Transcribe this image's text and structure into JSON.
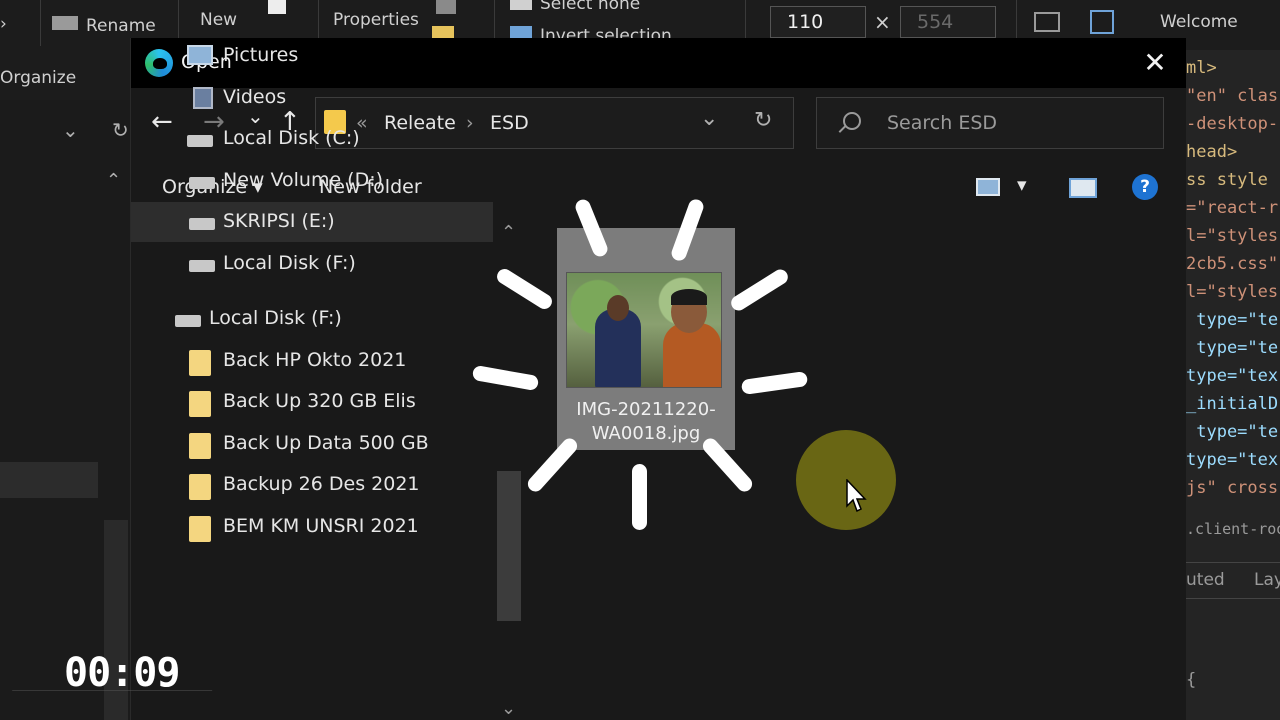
{
  "background": {
    "ribbon": {
      "rename": "Rename",
      "new": "New",
      "properties": "Properties",
      "select_none": "Select none",
      "invert_selection": "Invert selection",
      "organize": "Organize",
      "width": "110",
      "times": "×",
      "height": "554",
      "welcome": "Welcome"
    },
    "code_lines": [
      [
        "tag",
        "ml>"
      ],
      [
        "str",
        "\"en\" clas"
      ],
      [
        "str",
        "-desktop-"
      ],
      [
        "tag",
        "head>"
      ],
      [
        "tag",
        "ss style"
      ],
      [
        "str",
        "=\"react-r"
      ],
      [
        "str",
        "l=\"styles"
      ],
      [
        "str",
        "2cb5.css\""
      ],
      [
        "str",
        "l=\"styles"
      ],
      [
        "attr",
        " type=\"te"
      ],
      [
        "attr",
        " type=\"te"
      ],
      [
        "attr",
        "type=\"tex"
      ],
      [
        "attr",
        "_initialD"
      ],
      [
        "attr",
        " type=\"te"
      ],
      [
        "attr",
        "type=\"tex"
      ],
      [
        "str",
        "js\" cross"
      ]
    ],
    "code_selector": ".client-root",
    "code_tabs": [
      "uted",
      "Lay"
    ],
    "code_brace": "{"
  },
  "dialog": {
    "title": "Open",
    "close_glyph": "✕",
    "nav": {
      "back_glyph": "←",
      "forward_glyph": "→",
      "recent_glyph": "⌄",
      "up_glyph": "↑"
    },
    "address": {
      "overflow": "«",
      "crumbs": [
        "Releate",
        "ESD"
      ],
      "separator": "›",
      "dropdown_glyph": "⌄",
      "refresh_glyph": "↻"
    },
    "search": {
      "placeholder": "Search ESD"
    },
    "commands": {
      "organize": "Organize ▾",
      "new_folder": "New folder",
      "view_dropdown": "▾",
      "help": "?"
    },
    "nav_pane": {
      "items": [
        {
          "label": "Pictures",
          "icon": "pictures-icon"
        },
        {
          "label": "Videos",
          "icon": "videos-icon"
        },
        {
          "label": "Local Disk (C:)",
          "icon": "system-drive-icon"
        },
        {
          "label": "New Volume (D:)",
          "icon": "drive-icon"
        },
        {
          "label": "SKRIPSI (E:)",
          "icon": "drive-icon",
          "selected": true
        },
        {
          "label": "Local Disk (F:)",
          "icon": "drive-icon"
        },
        {
          "label": "Local Disk (F:)",
          "icon": "drive-icon"
        },
        {
          "label": "Back HP Okto 2021",
          "icon": "folder-icon"
        },
        {
          "label": "Back Up 320 GB Elis",
          "icon": "folder-icon"
        },
        {
          "label": "Back Up Data 500 GB",
          "icon": "folder-icon"
        },
        {
          "label": "Backup 26 Des 2021",
          "icon": "folder-icon"
        },
        {
          "label": "BEM KM UNSRI 2021",
          "icon": "folder-icon"
        }
      ],
      "scroll_up": "⌃",
      "scroll_down": "⌄"
    },
    "files": [
      {
        "name": "IMG-20211220-WA0018.jpg",
        "selected": true
      }
    ]
  },
  "overlay": {
    "timer": "00:09",
    "highlight_color": "#706c14"
  }
}
